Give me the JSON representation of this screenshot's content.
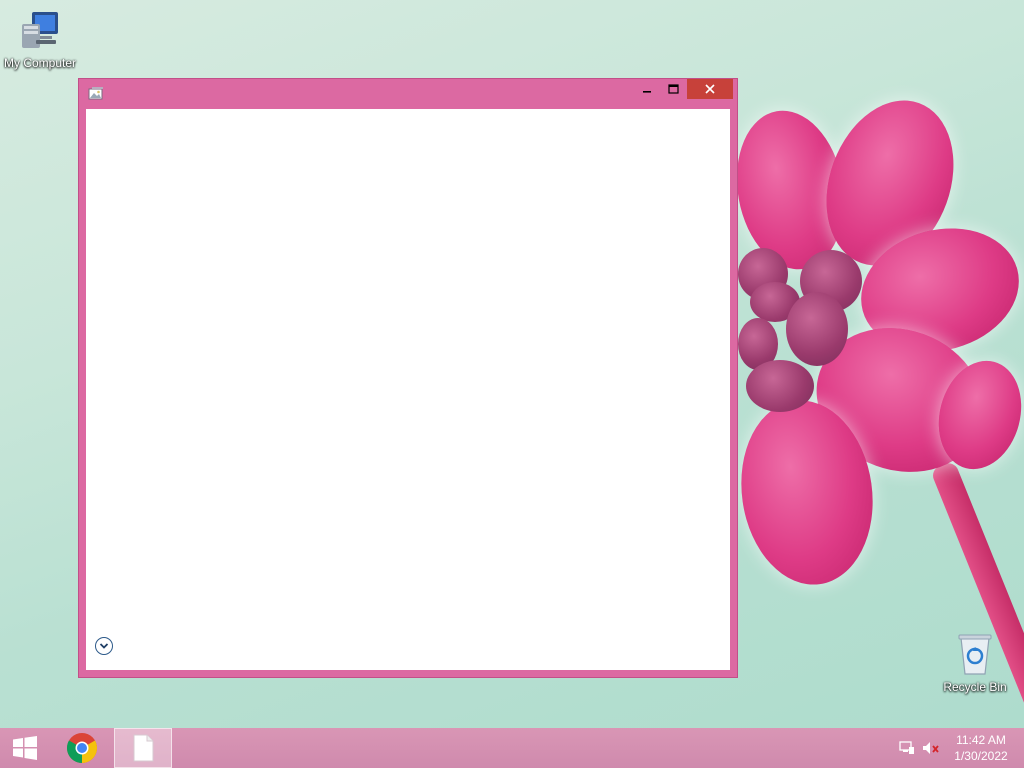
{
  "desktop": {
    "icons": [
      {
        "label": "My Computer",
        "icon": "computer-icon"
      },
      {
        "label": "Recycle Bin",
        "icon": "recycle-bin-icon"
      }
    ]
  },
  "window": {
    "title": "",
    "icon": "image-viewer-icon",
    "controls": {
      "minimize": "minimize-icon",
      "maximize": "maximize-icon",
      "close": "close-icon"
    },
    "expand_icon": "chevron-down-icon"
  },
  "taskbar": {
    "items": [
      {
        "name": "start",
        "icon": "windows-logo-icon"
      },
      {
        "name": "chrome",
        "icon": "chrome-icon"
      },
      {
        "name": "file",
        "icon": "document-icon"
      }
    ],
    "tray": {
      "network_icon": "network-icon",
      "volume_icon": "volume-muted-icon",
      "time": "11:42 AM",
      "date": "1/30/2022"
    }
  },
  "colors": {
    "window_frame": "#dc69a2",
    "close_button": "#c7413a",
    "taskbar": "#d38fb0"
  }
}
